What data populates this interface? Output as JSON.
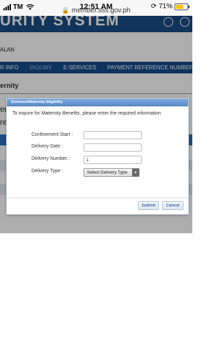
{
  "status_bar": {
    "carrier": "TM",
    "time": "12:51 AM",
    "battery_percent_label": "71%",
    "battery_level": 0.71
  },
  "browser": {
    "url": "member.sss.gov.ph"
  },
  "page": {
    "header_title": "URITY SYSTEM",
    "user_name": "ALAN",
    "nav": [
      "R INFO",
      "INQUIRY",
      "E-SERVICES",
      "PAYMENT REFERENCE NUMBER(PRN)"
    ],
    "section_title": "ernity",
    "background_fragments": [
      "er",
      "re"
    ]
  },
  "dialog": {
    "title": "Sickness/Maternity Eligibility",
    "instruction": "To inquire for Maternity Benefits, please enter the required information:",
    "fields": [
      {
        "label": "Confinement Start :",
        "value": ""
      },
      {
        "label": "Delivery Date :",
        "value": ""
      },
      {
        "label": "Delivery Number :",
        "value": "1"
      }
    ],
    "delivery_type_label": "Delivery Type :",
    "delivery_type_value": "Select Delivery Type",
    "submit_label": "Submit",
    "cancel_label": "Cancel"
  },
  "colors": {
    "header_blue": "#1a4d85",
    "nav_blue": "#154c8c",
    "dialog_title": "#5b8ccb",
    "button_text": "#3d6aa3"
  }
}
